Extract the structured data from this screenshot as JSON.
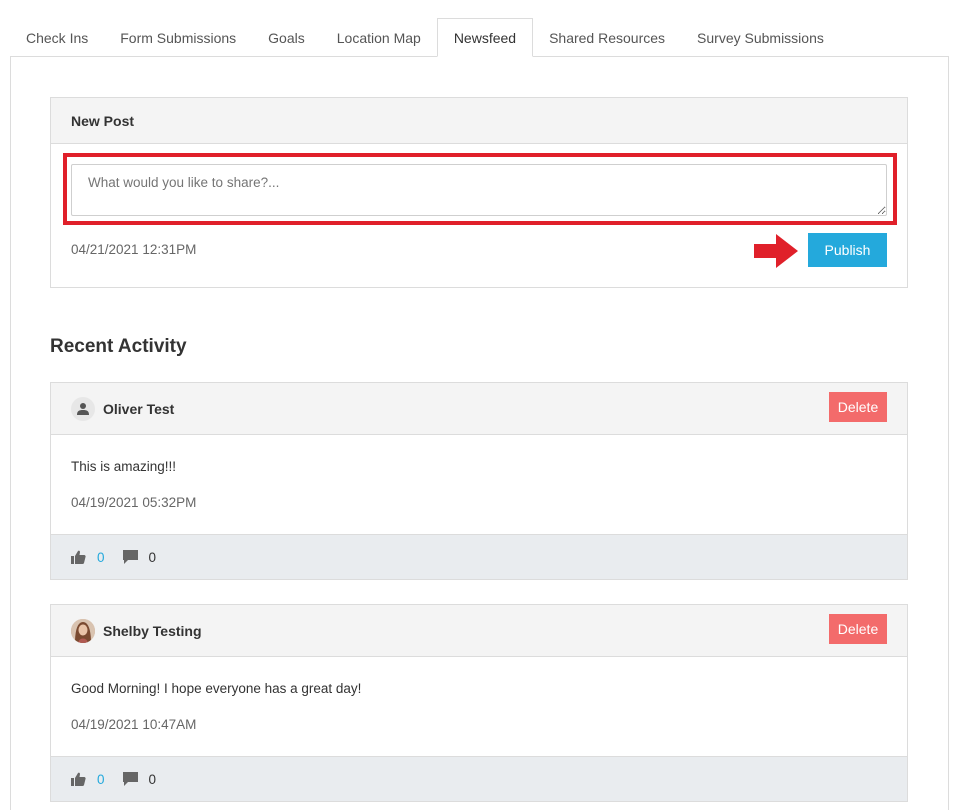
{
  "tabs": [
    {
      "label": "Check Ins"
    },
    {
      "label": "Form Submissions"
    },
    {
      "label": "Goals"
    },
    {
      "label": "Location Map"
    },
    {
      "label": "Newsfeed",
      "active": true
    },
    {
      "label": "Shared Resources"
    },
    {
      "label": "Survey Submissions"
    }
  ],
  "new_post": {
    "title": "New Post",
    "placeholder": "What would you like to share?...",
    "value": "",
    "date": "04/21/2021 12:31PM",
    "publish_label": "Publish"
  },
  "recent_activity": {
    "title": "Recent Activity",
    "posts": [
      {
        "author": "Oliver Test",
        "message": "This is amazing!!!",
        "date": "04/19/2021 05:32PM",
        "likes": "0",
        "comments": "0",
        "delete_label": "Delete",
        "avatar_icon": "user-icon"
      },
      {
        "author": "Shelby Testing",
        "message": "Good Morning! I hope everyone has a great day!",
        "date": "04/19/2021 10:47AM",
        "likes": "0",
        "comments": "0",
        "delete_label": "Delete",
        "avatar_icon": "user-photo"
      }
    ]
  },
  "colors": {
    "accent": "#24a9dc",
    "delete": "#f36b6b",
    "highlight": "#e0202a"
  }
}
